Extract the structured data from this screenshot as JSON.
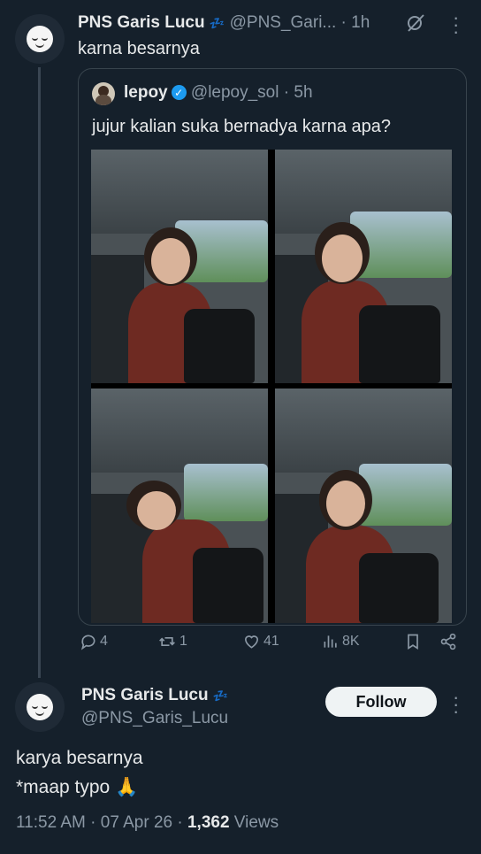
{
  "tweet": {
    "author_name": "PNS Garis Lucu",
    "author_emoji": "💤",
    "handle": "@PNS_Gari...",
    "time": "· 1h",
    "text": "karna besarnya"
  },
  "quote": {
    "author_name": "lepoy",
    "handle": "@lepoy_sol",
    "time": "· 5h",
    "text": "jujur kalian suka bernadya karna apa?"
  },
  "actions": {
    "replies": "4",
    "retweets": "1",
    "likes": "41",
    "views": "8K"
  },
  "reply": {
    "author_name": "PNS Garis Lucu",
    "author_emoji": "💤",
    "handle": "@PNS_Garis_Lucu",
    "follow_label": "Follow",
    "text_line1": "karya besarnya",
    "text_line2": "*maap typo 🙏",
    "timestamp": "11:52 AM · 07 Apr 26 · ",
    "views_count": "1,362",
    "views_label": " Views"
  },
  "icons": {
    "reply": "reply-icon",
    "retweet": "retweet-icon",
    "like": "heart-icon",
    "views": "views-icon",
    "bookmark": "bookmark-icon",
    "share": "share-icon",
    "grok": "grok-icon",
    "more": "more-icon"
  },
  "colors": {
    "background": "#15202b",
    "verified": "#1d9bf0",
    "muted": "#8b98a5"
  }
}
